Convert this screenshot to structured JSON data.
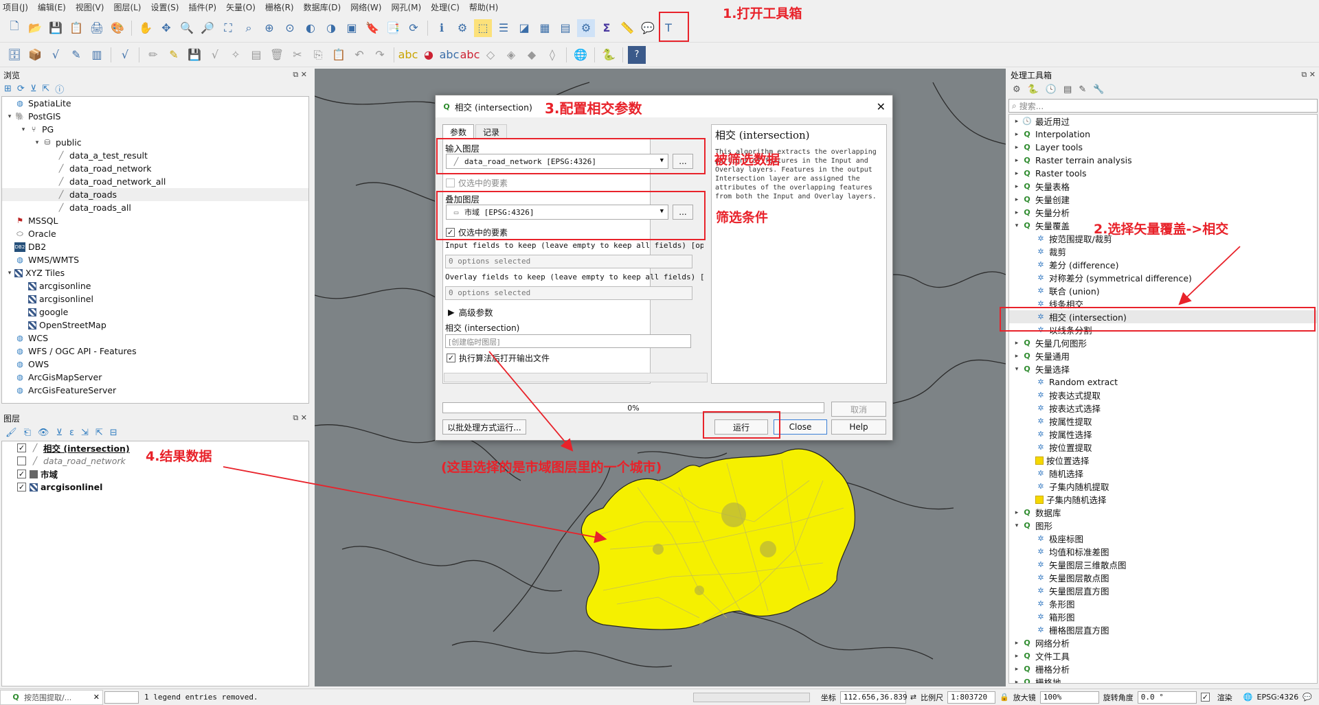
{
  "menu": [
    "项目(J)",
    "编辑(E)",
    "视图(V)",
    "图层(L)",
    "设置(S)",
    "插件(P)",
    "矢量(O)",
    "栅格(R)",
    "数据库(D)",
    "网络(W)",
    "网孔(M)",
    "处理(C)",
    "帮助(H)"
  ],
  "browser": {
    "title": "浏览",
    "items": [
      {
        "label": "SpatiaLite",
        "level": 0,
        "arrow": "",
        "icon": "spatialite-icon"
      },
      {
        "label": "PostGIS",
        "level": 0,
        "arrow": "▾",
        "icon": "postgis-icon"
      },
      {
        "label": "PG",
        "level": 1,
        "arrow": "▾",
        "icon": "connection-icon"
      },
      {
        "label": "public",
        "level": 2,
        "arrow": "▾",
        "icon": "schema-icon"
      },
      {
        "label": "data_a_test_result",
        "level": 3,
        "arrow": "",
        "icon": "line-layer-icon"
      },
      {
        "label": "data_road_network",
        "level": 3,
        "arrow": "",
        "icon": "line-layer-icon"
      },
      {
        "label": "data_road_network_all",
        "level": 3,
        "arrow": "",
        "icon": "line-layer-icon"
      },
      {
        "label": "data_roads",
        "level": 3,
        "arrow": "",
        "icon": "line-layer-icon"
      },
      {
        "label": "data_roads_all",
        "level": 3,
        "arrow": "",
        "icon": "line-layer-icon"
      },
      {
        "label": "MSSQL",
        "level": 0,
        "arrow": "",
        "icon": "mssql-icon"
      },
      {
        "label": "Oracle",
        "level": 0,
        "arrow": "",
        "icon": "oracle-icon"
      },
      {
        "label": "DB2",
        "level": 0,
        "arrow": "",
        "icon": "db2-icon"
      },
      {
        "label": "WMS/WMTS",
        "level": 0,
        "arrow": "",
        "icon": "wms-icon"
      },
      {
        "label": "XYZ Tiles",
        "level": 0,
        "arrow": "▾",
        "icon": "xyz-icon"
      },
      {
        "label": "arcgisonline",
        "level": 1,
        "arrow": "",
        "icon": "tile-icon"
      },
      {
        "label": "arcgisonlinel",
        "level": 1,
        "arrow": "",
        "icon": "tile-icon"
      },
      {
        "label": "google",
        "level": 1,
        "arrow": "",
        "icon": "tile-icon"
      },
      {
        "label": "OpenStreetMap",
        "level": 1,
        "arrow": "",
        "icon": "tile-icon"
      },
      {
        "label": "WCS",
        "level": 0,
        "arrow": "",
        "icon": "wcs-icon"
      },
      {
        "label": "WFS / OGC API - Features",
        "level": 0,
        "arrow": "",
        "icon": "wfs-icon"
      },
      {
        "label": "OWS",
        "level": 0,
        "arrow": "",
        "icon": "ows-icon"
      },
      {
        "label": "ArcGisMapServer",
        "level": 0,
        "arrow": "",
        "icon": "arcgis-icon"
      },
      {
        "label": "ArcGisFeatureServer",
        "level": 0,
        "arrow": "",
        "icon": "arcgis-icon"
      }
    ]
  },
  "layers": {
    "title": "图层",
    "items": [
      {
        "label": "相交 (intersection)",
        "checked": "✓",
        "style": "bold-underline",
        "icon": "line-layer-icon"
      },
      {
        "label": "data_road_network",
        "checked": "",
        "style": "italic",
        "icon": "line-layer-icon"
      },
      {
        "label": "市域",
        "checked": "✓",
        "style": "bold",
        "icon": "polygon-layer-icon"
      },
      {
        "label": "arcgisonlinel",
        "checked": "✓",
        "style": "bold",
        "icon": "tile-icon"
      }
    ]
  },
  "toolbox": {
    "title": "处理工具箱",
    "search_placeholder": "搜索...",
    "items": [
      {
        "label": "最近用过",
        "level": 0,
        "arrow": "▸",
        "icon": "clock-icon"
      },
      {
        "label": "Interpolation",
        "level": 0,
        "arrow": "▸",
        "icon": "qgis-icon"
      },
      {
        "label": "Layer tools",
        "level": 0,
        "arrow": "▸",
        "icon": "qgis-icon"
      },
      {
        "label": "Raster terrain analysis",
        "level": 0,
        "arrow": "▸",
        "icon": "qgis-icon"
      },
      {
        "label": "Raster tools",
        "level": 0,
        "arrow": "▸",
        "icon": "qgis-icon"
      },
      {
        "label": "矢量表格",
        "level": 0,
        "arrow": "▸",
        "icon": "qgis-icon"
      },
      {
        "label": "矢量创建",
        "level": 0,
        "arrow": "▸",
        "icon": "qgis-icon"
      },
      {
        "label": "矢量分析",
        "level": 0,
        "arrow": "▸",
        "icon": "qgis-icon"
      },
      {
        "label": "矢量覆盖",
        "level": 0,
        "arrow": "▾",
        "icon": "qgis-icon"
      },
      {
        "label": "按范围提取/裁剪",
        "level": 1,
        "arrow": "",
        "icon": "algo-icon"
      },
      {
        "label": "裁剪",
        "level": 1,
        "arrow": "",
        "icon": "algo-icon"
      },
      {
        "label": "差分 (difference)",
        "level": 1,
        "arrow": "",
        "icon": "algo-icon"
      },
      {
        "label": "对称差分 (symmetrical difference)",
        "level": 1,
        "arrow": "",
        "icon": "algo-icon"
      },
      {
        "label": "联合 (union)",
        "level": 1,
        "arrow": "",
        "icon": "algo-icon"
      },
      {
        "label": "线条相交",
        "level": 1,
        "arrow": "",
        "icon": "algo-icon"
      },
      {
        "label": "相交 (intersection)",
        "level": 1,
        "arrow": "",
        "icon": "algo-icon"
      },
      {
        "label": "以线条分割",
        "level": 1,
        "arrow": "",
        "icon": "algo-icon"
      },
      {
        "label": "矢量几何图形",
        "level": 0,
        "arrow": "▸",
        "icon": "qgis-icon"
      },
      {
        "label": "矢量通用",
        "level": 0,
        "arrow": "▸",
        "icon": "qgis-icon"
      },
      {
        "label": "矢量选择",
        "level": 0,
        "arrow": "▾",
        "icon": "qgis-icon"
      },
      {
        "label": "Random extract",
        "level": 1,
        "arrow": "",
        "icon": "gear-icon"
      },
      {
        "label": "按表达式提取",
        "level": 1,
        "arrow": "",
        "icon": "gear-icon"
      },
      {
        "label": "按表达式选择",
        "level": 1,
        "arrow": "",
        "icon": "gear-icon"
      },
      {
        "label": "按属性提取",
        "level": 1,
        "arrow": "",
        "icon": "gear-icon"
      },
      {
        "label": "按属性选择",
        "level": 1,
        "arrow": "",
        "icon": "gear-icon"
      },
      {
        "label": "按位置提取",
        "level": 1,
        "arrow": "",
        "icon": "gear-icon"
      },
      {
        "label": "按位置选择",
        "level": 1,
        "arrow": "",
        "icon": "select-icon"
      },
      {
        "label": "随机选择",
        "level": 1,
        "arrow": "",
        "icon": "gear-icon"
      },
      {
        "label": "子集内随机提取",
        "level": 1,
        "arrow": "",
        "icon": "gear-icon"
      },
      {
        "label": "子集内随机选择",
        "level": 1,
        "arrow": "",
        "icon": "select-icon"
      },
      {
        "label": "数据库",
        "level": 0,
        "arrow": "▸",
        "icon": "qgis-icon"
      },
      {
        "label": "图形",
        "level": 0,
        "arrow": "▾",
        "icon": "qgis-icon"
      },
      {
        "label": "极座标图",
        "level": 1,
        "arrow": "",
        "icon": "gear-icon"
      },
      {
        "label": "均值和标准差图",
        "level": 1,
        "arrow": "",
        "icon": "gear-icon"
      },
      {
        "label": "矢量图层三维散点图",
        "level": 1,
        "arrow": "",
        "icon": "gear-icon"
      },
      {
        "label": "矢量图层散点图",
        "level": 1,
        "arrow": "",
        "icon": "gear-icon"
      },
      {
        "label": "矢量图层直方图",
        "level": 1,
        "arrow": "",
        "icon": "gear-icon"
      },
      {
        "label": "条形图",
        "level": 1,
        "arrow": "",
        "icon": "gear-icon"
      },
      {
        "label": "箱形图",
        "level": 1,
        "arrow": "",
        "icon": "gear-icon"
      },
      {
        "label": "栅格图层直方图",
        "level": 1,
        "arrow": "",
        "icon": "gear-icon"
      },
      {
        "label": "网络分析",
        "level": 0,
        "arrow": "▸",
        "icon": "qgis-icon"
      },
      {
        "label": "文件工具",
        "level": 0,
        "arrow": "▸",
        "icon": "qgis-icon"
      },
      {
        "label": "栅格分析",
        "level": 0,
        "arrow": "▸",
        "icon": "qgis-icon"
      },
      {
        "label": "栅格地...",
        "level": 0,
        "arrow": "▸",
        "icon": "qgis-icon"
      }
    ]
  },
  "dialog": {
    "title": "相交 (intersection)",
    "tab_params": "参数",
    "tab_log": "记录",
    "input_label": "输入图层",
    "input_value": "data_road_network [EPSG:4326]",
    "input_selected_only": "仅选中的要素",
    "overlay_label": "叠加图层",
    "overlay_value": "市域 [EPSG:4326]",
    "overlay_selected_only": "仅选中的要素",
    "input_fields_label": "Input fields to keep (leave empty to keep all fields) [optional]",
    "input_fields_value": "0 options selected",
    "overlay_fields_label": "Overlay fields to keep (leave empty to keep all fields) [optional]",
    "overlay_fields_value": "0 options selected",
    "advanced": "高级参数",
    "output_label": "相交 (intersection)",
    "output_placeholder": "[创建临时图层]",
    "open_after": "执行算法后打开输出文件",
    "help_title": "相交 (intersection)",
    "help_text": "This algorithm extracts the overlapping portions of features in the Input and Overlay layers. Features in the output Intersection layer are assigned the attributes of the overlapping features from both the Input and Overlay layers.",
    "progress": "0%",
    "progress_value": 0,
    "cancel": "取消",
    "batch": "以批处理方式运行...",
    "run": "运行",
    "close": "Close",
    "help": "Help",
    "dots": "..."
  },
  "annotations": {
    "a1": "1.打开工具箱",
    "a2": "2.选择矢量覆盖->相交",
    "a3": "3.配置相交参数",
    "a4": "4.结果数据",
    "a5": "被筛选数据",
    "a6": "筛选条件",
    "a7": "(这里选择的是市域图层里的一个城市)",
    "color": "#e8222a"
  },
  "status": {
    "task": "按范围提取/...",
    "message": "1 legend entries removed.",
    "coord_label": "坐标",
    "coord_value": "112.656,36.839",
    "scale_label": "比例尺",
    "scale_value": "1:803720",
    "magnifier_label": "放大镜",
    "magnifier_value": "100%",
    "rotation_label": "旋转角度",
    "rotation_value": "0.0 °",
    "render_label": "渲染",
    "crs": "EPSG:4326"
  },
  "colors": {
    "accent": "#e8222a",
    "city": "#f5f000",
    "map_bg": "#7d8386"
  }
}
